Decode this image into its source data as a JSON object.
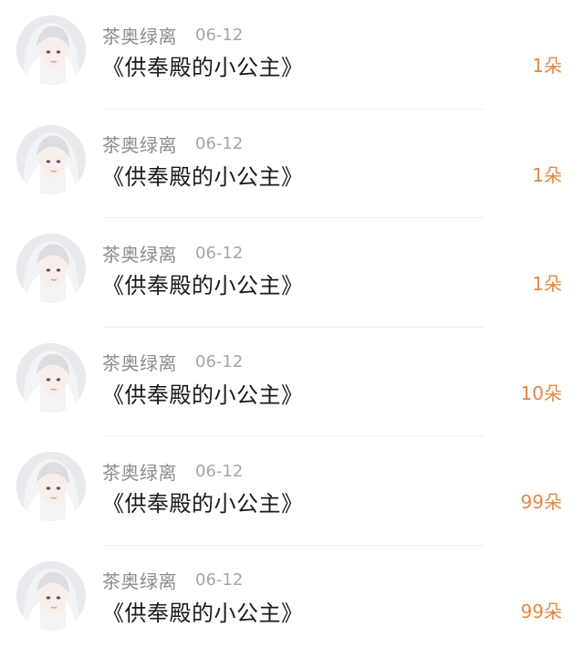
{
  "list": {
    "items": [
      {
        "username": "茶奥绿离",
        "date": "06-12",
        "title": "《供奉殿的小公主》",
        "gift": "1朵"
      },
      {
        "username": "茶奥绿离",
        "date": "06-12",
        "title": "《供奉殿的小公主》",
        "gift": "1朵"
      },
      {
        "username": "茶奥绿离",
        "date": "06-12",
        "title": "《供奉殿的小公主》",
        "gift": "1朵"
      },
      {
        "username": "茶奥绿离",
        "date": "06-12",
        "title": "《供奉殿的小公主》",
        "gift": "10朵"
      },
      {
        "username": "茶奥绿离",
        "date": "06-12",
        "title": "《供奉殿的小公主》",
        "gift": "99朵"
      },
      {
        "username": "茶奥绿离",
        "date": "06-12",
        "title": "《供奉殿的小公主》",
        "gift": "99朵"
      }
    ]
  },
  "colors": {
    "accent": "#e28843",
    "username": "#8c8c8c",
    "date": "#a6a6a6",
    "title": "#1a1a1a",
    "divider": "#efefef"
  },
  "icons": {
    "avatar": "user-avatar-anime-girl"
  }
}
